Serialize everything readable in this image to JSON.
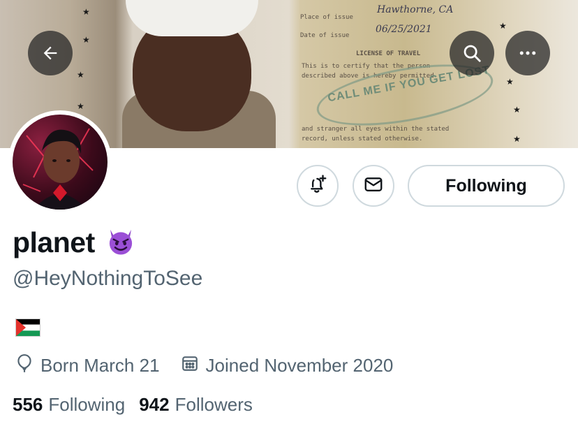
{
  "header": {
    "back_icon": "arrow-left-icon",
    "search_icon": "search-icon",
    "more_icon": "more-horizontal-icon",
    "banner": {
      "handwritten_place": "Hawthorne, CA",
      "handwritten_date": "06/25/2021",
      "doc_lines": [
        "Place of issue",
        "Date of issue",
        "LICENSE OF TRAVEL",
        "This is to certify that the person",
        "described above is hereby permitted",
        "and stranger all eyes within the stated",
        "record, unless stated otherwise."
      ],
      "stamp_text": "CALL ME IF YOU GET LOST"
    }
  },
  "actions": {
    "notify_icon": "bell-plus-icon",
    "message_icon": "mail-icon",
    "following_label": "Following"
  },
  "profile": {
    "display_name": "planet",
    "name_emoji": "smiling-face-with-horns",
    "handle": "@HeyNothingToSee",
    "bio_emoji": "palestine-flag",
    "birthday": "Born March 21",
    "joined": "Joined November 2020"
  },
  "stats": {
    "following_count": "556",
    "following_label": "Following",
    "followers_count": "942",
    "followers_label": "Followers"
  },
  "colors": {
    "text_primary": "#0f1419",
    "text_secondary": "#536471",
    "border": "#cfd9de",
    "devil_purple": "#9b4fd6"
  }
}
